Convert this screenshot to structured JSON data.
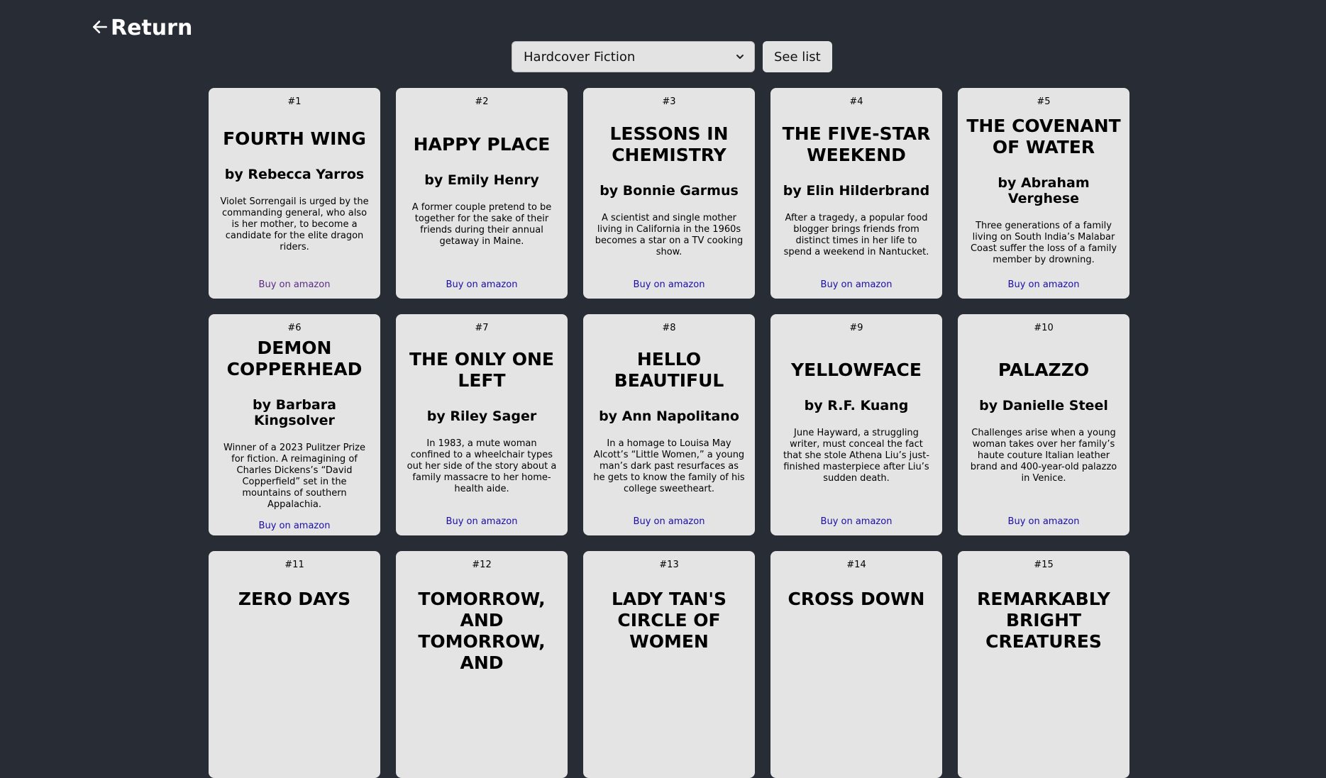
{
  "nav": {
    "return_label": "Return"
  },
  "controls": {
    "selected_list": "Hardcover Fiction",
    "see_list_label": "See list"
  },
  "books": [
    {
      "rank": "#1",
      "title": "FOURTH WING",
      "author": "by Rebecca Yarros",
      "description": "Violet Sorrengail is urged by the commanding general, who also is her mother, to become a candidate for the elite dragon riders.",
      "buy_label": "Buy on amazon"
    },
    {
      "rank": "#2",
      "title": "HAPPY PLACE",
      "author": "by Emily Henry",
      "description": "A former couple pretend to be together for the sake of their friends during their annual getaway in Maine.",
      "buy_label": "Buy on amazon"
    },
    {
      "rank": "#3",
      "title": "LESSONS IN CHEMISTRY",
      "author": "by Bonnie Garmus",
      "description": "A scientist and single mother living in California in the 1960s becomes a star on a TV cooking show.",
      "buy_label": "Buy on amazon"
    },
    {
      "rank": "#4",
      "title": "THE FIVE-STAR WEEKEND",
      "author": "by Elin Hilderbrand",
      "description": "After a tragedy, a popular food blogger brings friends from distinct times in her life to spend a weekend in Nantucket.",
      "buy_label": "Buy on amazon"
    },
    {
      "rank": "#5",
      "title": "THE COVENANT OF WATER",
      "author": "by Abraham Verghese",
      "description": "Three generations of a family living on South India’s Malabar Coast suffer the loss of a family member by drowning.",
      "buy_label": "Buy on amazon"
    },
    {
      "rank": "#6",
      "title": "DEMON COPPERHEAD",
      "author": "by Barbara Kingsolver",
      "description": "Winner of a 2023 Pulitzer Prize for fiction. A reimagining of Charles Dickens’s “David Copperfield” set in the mountains of southern Appalachia.",
      "buy_label": "Buy on amazon"
    },
    {
      "rank": "#7",
      "title": "THE ONLY ONE LEFT",
      "author": "by Riley Sager",
      "description": "In 1983, a mute woman confined to a wheelchair types out her side of the story about a family massacre to her home-health aide.",
      "buy_label": "Buy on amazon"
    },
    {
      "rank": "#8",
      "title": "HELLO BEAUTIFUL",
      "author": "by Ann Napolitano",
      "description": "In a homage to Louisa May Alcott’s “Little Women,” a young man’s dark past resurfaces as he gets to know the family of his college sweetheart.",
      "buy_label": "Buy on amazon"
    },
    {
      "rank": "#9",
      "title": "YELLOWFACE",
      "author": "by R.F. Kuang",
      "description": "June Hayward, a struggling writer, must conceal the fact that she stole Athena Liu’s just-finished masterpiece after Liu’s sudden death.",
      "buy_label": "Buy on amazon"
    },
    {
      "rank": "#10",
      "title": "PALAZZO",
      "author": "by Danielle Steel",
      "description": "Challenges arise when a young woman takes over her family’s haute couture Italian leather brand and 400-year-old palazzo in Venice.",
      "buy_label": "Buy on amazon"
    },
    {
      "rank": "#11",
      "title": "ZERO DAYS"
    },
    {
      "rank": "#12",
      "title": "TOMORROW, AND TOMORROW, AND"
    },
    {
      "rank": "#13",
      "title": "LADY TAN'S CIRCLE OF WOMEN"
    },
    {
      "rank": "#14",
      "title": "CROSS DOWN"
    },
    {
      "rank": "#15",
      "title": "REMARKABLY BRIGHT CREATURES"
    }
  ]
}
